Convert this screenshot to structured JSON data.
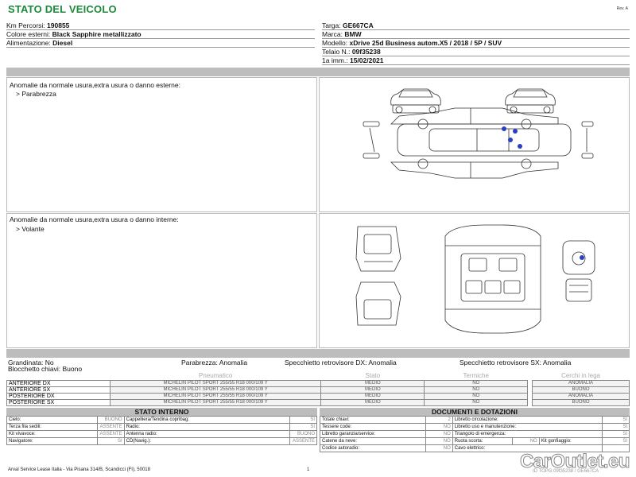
{
  "header": {
    "title": "STATO DEL VEICOLO",
    "rev": "Rev. A"
  },
  "vehicle_left": [
    {
      "label": "Km Percorsi:",
      "value": "190855"
    },
    {
      "label": "Colore esterni:",
      "value": "Black Sapphire metallizzato"
    },
    {
      "label": "Alimentazione:",
      "value": "Diesel"
    }
  ],
  "vehicle_right": [
    {
      "label": "Targa:",
      "value": "GE667CA"
    },
    {
      "label": "Marca:",
      "value": "BMW"
    },
    {
      "label": "Modello:",
      "value": "xDrive 25d Business autom.X5 / 2018 / 5P / SUV"
    },
    {
      "label": "Telaio N.:",
      "value": "09f35238"
    },
    {
      "label": "1a imm.:",
      "value": "15/02/2021"
    }
  ],
  "external": {
    "title": "Anomalie da normale usura,extra usura o danno esterne:",
    "item": "> Parabrezza"
  },
  "internal": {
    "title": "Anomalie da normale usura,extra usura o danno interne:",
    "item": "> Volante"
  },
  "summary": {
    "grandinata": "Grandinata: No",
    "blocchetto": "Blocchetto chiavi: Buono",
    "parabrezza": "Parabrezza: Anomalia",
    "specchietto_dx": "Specchietto retrovisore DX: Anomalia",
    "specchietto_sx": "Specchietto retrovisore SX: Anomalia"
  },
  "tyres": {
    "headers": [
      "Pneumatico",
      "Stato",
      "Termiche",
      "Cerchi in lega"
    ],
    "rows": [
      {
        "position": "ANTERIORE DX",
        "tyre": "MICHELIN PILOT SPORT 255/55 R18 000/109 Y",
        "stato": "MEDIO",
        "termiche": "NO",
        "cerchi": "ANOMALIA"
      },
      {
        "position": "ANTERIORE SX",
        "tyre": "MICHELIN PILOT SPORT 255/55 R18 000/109 Y",
        "stato": "MEDIO",
        "termiche": "NO",
        "cerchi": "BUONO"
      },
      {
        "position": "POSTERIORE DX",
        "tyre": "MICHELIN PILOT SPORT 255/55 R18 000/109 Y",
        "stato": "MEDIO",
        "termiche": "NO",
        "cerchi": "ANOMALIA"
      },
      {
        "position": "POSTERIORE SX",
        "tyre": "MICHELIN PILOT SPORT 255/55 R18 000/109 Y",
        "stato": "MEDIO",
        "termiche": "NO",
        "cerchi": "BUONO"
      }
    ]
  },
  "stato_interno": {
    "title": "STATO INTERNO",
    "rows": [
      [
        {
          "label": "Cielo:",
          "value": "BUONO"
        },
        {
          "label": "Cappelliera/Tendina copribag:",
          "value": "SI"
        }
      ],
      [
        {
          "label": "Terza fila sedili:",
          "value": "ASSENTE"
        },
        {
          "label": "Radio:",
          "value": "SI"
        }
      ],
      [
        {
          "label": "Kit vivavoce:",
          "value": "ASSENTE"
        },
        {
          "label": "Antenna radio:",
          "value": "BUONO"
        }
      ],
      [
        {
          "label": "Navigatore:",
          "value": "SI"
        },
        {
          "label": "CD(Navig.):",
          "value": "ASSENTE"
        }
      ]
    ]
  },
  "documenti": {
    "title": "DOCUMENTI E DOTAZIONI",
    "rows": [
      [
        {
          "label": "Totale chiavi:",
          "value": "2"
        },
        {
          "label": "Libretto circolazione:",
          "value": "SI"
        }
      ],
      [
        {
          "label": "Tessere code:",
          "value": "NO"
        },
        {
          "label": "Libretto uso e manutenzione:",
          "value": "SI"
        }
      ],
      [
        {
          "label": "Libretto garanzia/service:",
          "value": "NO"
        },
        {
          "label": "Triangolo di emergenza:",
          "value": "SI"
        }
      ],
      [
        {
          "label": "Catene da neve:",
          "value": "NO"
        },
        {
          "label": "Ruota scorta:",
          "value": "NO"
        },
        {
          "label": "Kit gonfiaggio:",
          "value": "SI"
        }
      ],
      [
        {
          "label": "Codice autoradio:",
          "value": "NO"
        },
        {
          "label": "Cavo elettrico:",
          "value": ""
        }
      ]
    ]
  },
  "footer": {
    "company": "Arval Service Lease Italia - Via Pisana 314/B, Scandicci (FI), 50018",
    "page": "1",
    "code": "ID TOPG.09f35238 / GE667CA"
  },
  "watermark": "CarOutlet.eu",
  "colors": {
    "title": "#1c8a3a",
    "band": "#bdbdbd",
    "marker": "#2a3fc8"
  }
}
